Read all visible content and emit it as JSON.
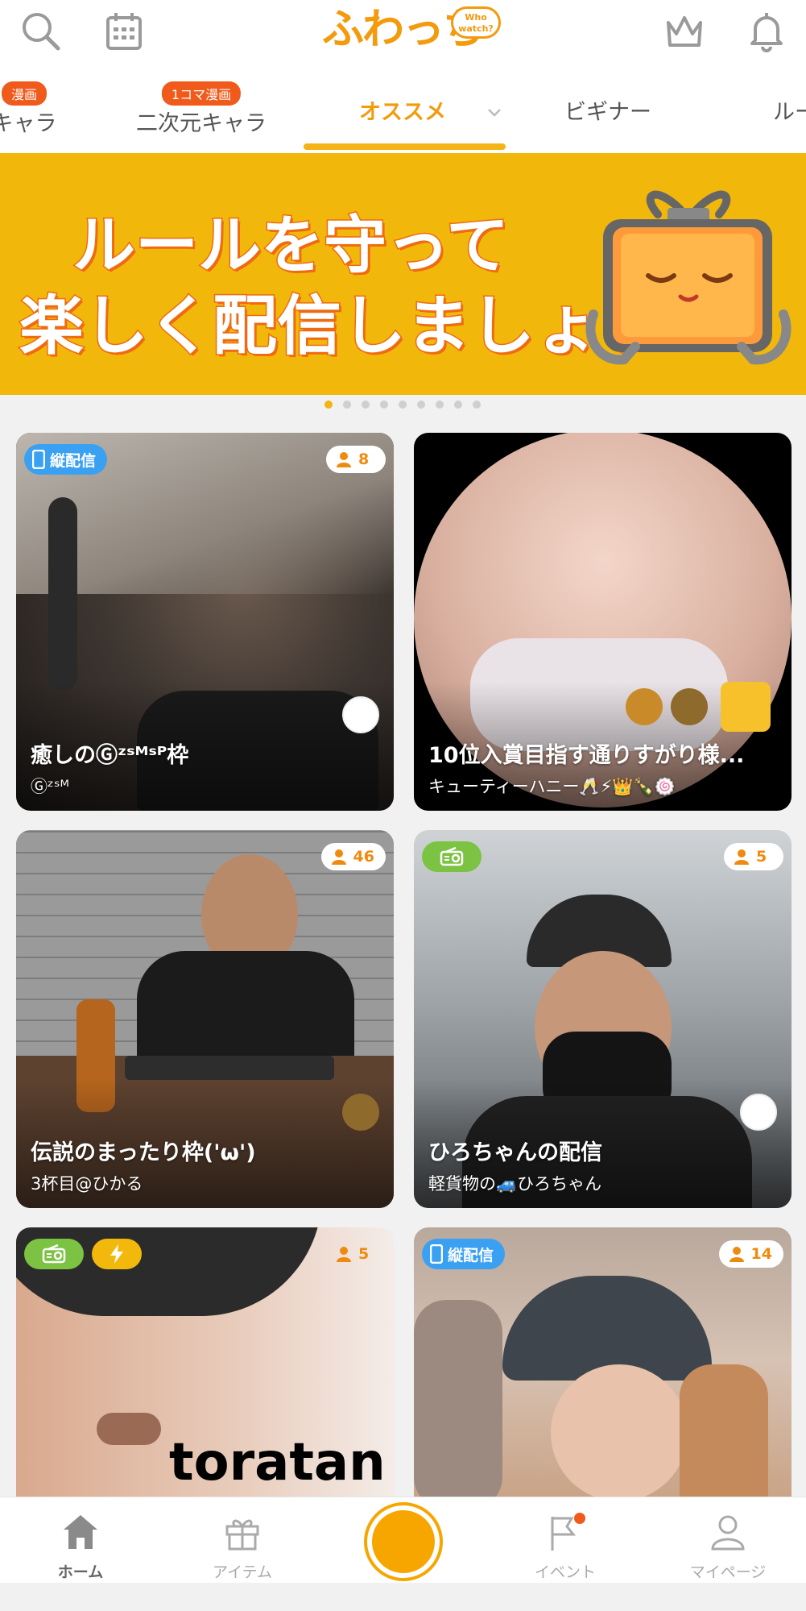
{
  "header": {
    "logo_text": "ふわっち",
    "logo_bubble": "Who watch?",
    "icons": [
      "search-icon",
      "calendar-icon",
      "crown-icon",
      "bell-icon"
    ]
  },
  "tabs": [
    {
      "label": "キャラ",
      "badge": "漫画"
    },
    {
      "label": "二次元キャラ",
      "badge": "1コマ漫画"
    },
    {
      "label": "オススメ",
      "badge": "",
      "active": true
    },
    {
      "label": "ビギナー",
      "badge": ""
    },
    {
      "label": "ルー",
      "badge": ""
    }
  ],
  "banner": {
    "line1": "ルールを守って",
    "line2": "楽しく配信しましょう",
    "page_count": 9,
    "active_page": 1
  },
  "cards": [
    {
      "title": "癒しのⒼᶻˢᴹˢᴾ枠",
      "subtitle": "Ⓖᶻˢᴹ",
      "viewers": "8",
      "badge": "縦配信"
    },
    {
      "title": "10位入賞目指す通りすがり様...",
      "subtitle": "キューティーハニー🥂⚡👑🍾🍥",
      "viewers": "",
      "badge": ""
    },
    {
      "title": "伝説のまったり枠('ω')",
      "subtitle": "3杯目@ひかる",
      "viewers": "46",
      "badge": ""
    },
    {
      "title": "ひろちゃんの配信",
      "subtitle": "軽貨物の🚙ひろちゃん",
      "viewers": "5",
      "badge": "radio"
    },
    {
      "title": "toratan",
      "subtitle": "",
      "viewers": "5",
      "badge": "radio+bolt"
    },
    {
      "title": "",
      "subtitle": "",
      "viewers": "14",
      "badge": "縦配信"
    }
  ],
  "bottom_nav": [
    {
      "label": "ホーム",
      "active": true
    },
    {
      "label": "アイテム",
      "active": false
    },
    {
      "label": "",
      "active": false
    },
    {
      "label": "イベント",
      "active": false
    },
    {
      "label": "マイページ",
      "active": false
    }
  ],
  "colors": {
    "accent": "#f39a0d",
    "banner_bg": "#f2b70b",
    "vertical_badge": "#3aa1f2",
    "radio_badge": "#7cc243",
    "notification_dot": "#f05a1a"
  }
}
